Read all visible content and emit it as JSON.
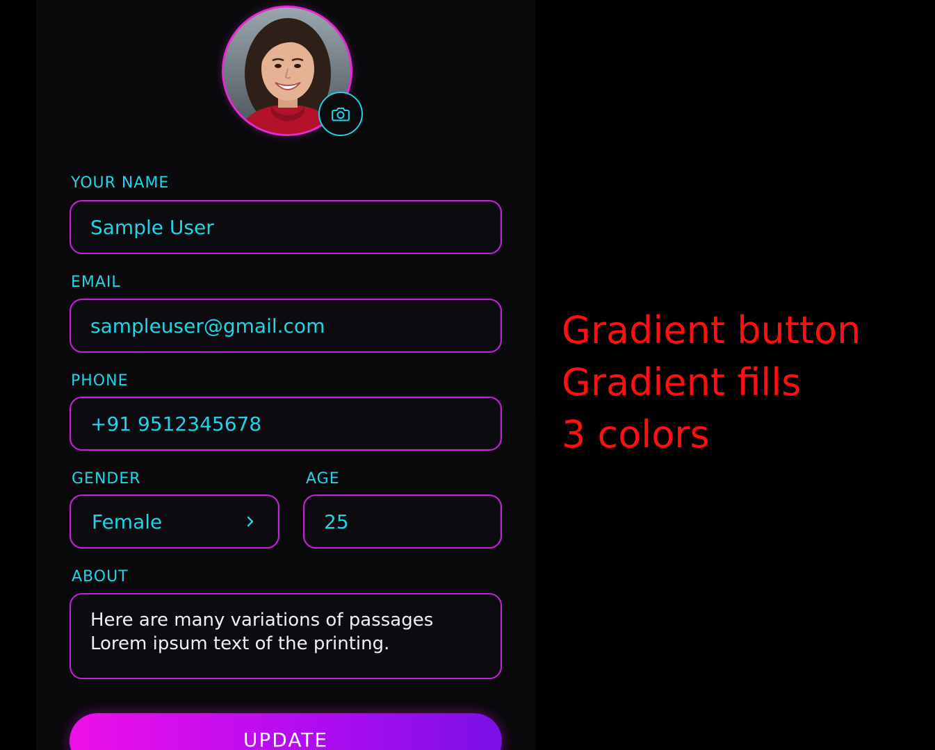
{
  "profile": {
    "avatar_alt": "Profile photo",
    "camera_icon": "camera-icon"
  },
  "form": {
    "name_label": "YOUR NAME",
    "name_value": "Sample User",
    "email_label": "EMAIL",
    "email_value": "sampleuser@gmail.com",
    "phone_label": "PHONE",
    "phone_value": "+91 9512345678",
    "gender_label": "GENDER",
    "gender_value": "Female",
    "age_label": "AGE",
    "age_value": "25",
    "about_label": "ABOUT",
    "about_line1": "Here are many variations of passages",
    "about_line2": "Lorem ipsum text of the printing.",
    "update_label": "UPDATE"
  },
  "annotation": {
    "line1": "Gradient button",
    "line2": "Gradient fills",
    "line3": "3 colors"
  },
  "colors": {
    "accent_cyan": "#21d4e6",
    "border_magenta": "#c424d8",
    "button_start": "#ee10e8",
    "button_end": "#7a10e6",
    "annotation_red": "#ff1010"
  }
}
